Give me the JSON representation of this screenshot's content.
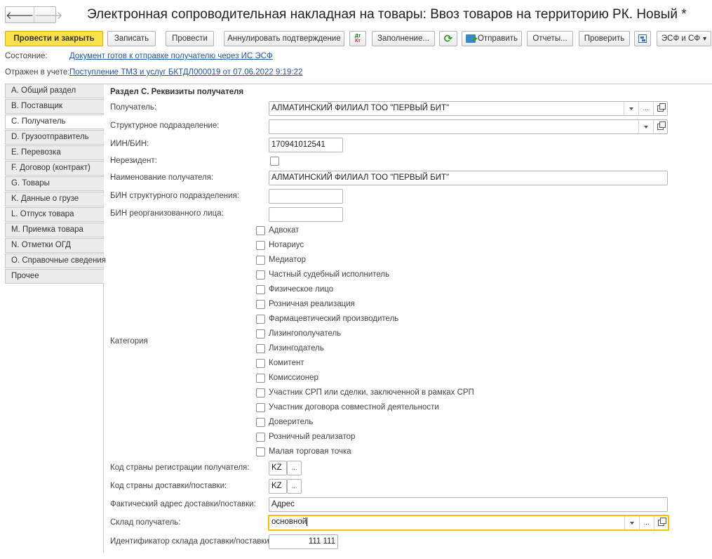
{
  "window": {
    "title": "Электронная сопроводительная накладная на товары: Ввоз товаров на территорию РК. Новый *",
    "back": "🡐",
    "forward": "🡒"
  },
  "toolbar": {
    "post_close": "Провести и закрыть",
    "save": "Записать",
    "post": "Провести",
    "cancel_confirm": "Аннулировать подтверждение",
    "dt": "Дт",
    "kt": "Кт",
    "fill": "Заполнение...",
    "refresh": "⟳",
    "send": "Отправить",
    "reports": "Отчеты...",
    "check": "Проверить",
    "esf": "ЭСФ и СФ",
    "esf_arrow": "▾"
  },
  "status": {
    "state_label": "Состояние:",
    "state_link": "Документ готов к отправке получателю через ИС ЭСФ",
    "reflected_label": "Отражен в учете:",
    "reflected_link": "Поступление ТМЗ и услуг БКТДЛ000019 от 07.06.2022 9:19:22"
  },
  "sidebar": {
    "items": [
      {
        "label": "A. Общий раздел",
        "active": false
      },
      {
        "label": "B. Поставщик",
        "active": false
      },
      {
        "label": "C. Получатель",
        "active": true
      },
      {
        "label": "D. Грузоотправитель",
        "active": false
      },
      {
        "label": "E. Перевозка",
        "active": false
      },
      {
        "label": "F. Договор (контракт)",
        "active": false
      },
      {
        "label": "G. Товары",
        "active": false
      },
      {
        "label": "K. Данные о грузе",
        "active": false
      },
      {
        "label": "L. Отпуск товара",
        "active": false
      },
      {
        "label": "M. Приемка товара",
        "active": false
      },
      {
        "label": "N. Отметки ОГД",
        "active": false
      },
      {
        "label": "O. Справочные сведения",
        "active": false
      },
      {
        "label": "Прочее",
        "active": false
      }
    ]
  },
  "form": {
    "section_title": "Раздел С. Реквизиты получателя",
    "recipient_label": "Получатель:",
    "recipient_value": "АЛМАТИНСКИЙ ФИЛИАЛ ТОО \"ПЕРВЫЙ БИТ\"",
    "subdivision_label": "Структурное подразделение:",
    "subdivision_value": "",
    "iin_label": "ИИН/БИН:",
    "iin_value": "170941012541",
    "nonresident_label": "Нерезидент:",
    "nonresident_checked": false,
    "name_label": "Наименование получателя:",
    "name_value": "АЛМАТИНСКИЙ ФИЛИАЛ ТОО \"ПЕРВЫЙ БИТ\"",
    "bin_sub_label": "БИН структурного подразделения:",
    "bin_sub_value": "",
    "bin_reorg_label": "БИН реорганизованного лица:",
    "bin_reorg_value": "",
    "category_label": "Категория",
    "categories": [
      {
        "label": "Адвокат",
        "checked": false
      },
      {
        "label": "Нотариус",
        "checked": false
      },
      {
        "label": "Медиатор",
        "checked": false
      },
      {
        "label": "Частный судебный исполнитель",
        "checked": false
      },
      {
        "label": "Физическое лицо",
        "checked": false
      },
      {
        "label": "Розничная реализация",
        "checked": false
      },
      {
        "label": "Фармацевтический производитель",
        "checked": false
      },
      {
        "label": "Лизингополучатель",
        "checked": false
      },
      {
        "label": "Лизингодатель",
        "checked": false
      },
      {
        "label": "Комитент",
        "checked": false
      },
      {
        "label": "Комиссионер",
        "checked": false
      },
      {
        "label": "Участник СРП или сделки, заключенной в рамках СРП",
        "checked": false
      },
      {
        "label": "Участник договора совместной деятельности",
        "checked": false
      },
      {
        "label": "Доверитель",
        "checked": false
      },
      {
        "label": "Розничный реализатор",
        "checked": false
      },
      {
        "label": "Малая торговая точка",
        "checked": false
      }
    ],
    "reg_country_label": "Код страны регистрации получателя:",
    "reg_country_value": "KZ",
    "delivery_country_label": "Код страны доставки/поставки:",
    "delivery_country_value": "KZ",
    "address_label": "Фактический адрес доставки/поставки:",
    "address_value": "Адрес",
    "warehouse_label": "Склад получатель:",
    "warehouse_value": "основной",
    "warehouse_id_label": "Идентификатор склада доставки/поставки:",
    "warehouse_id_value": "111 111",
    "ellipsis": "..."
  }
}
